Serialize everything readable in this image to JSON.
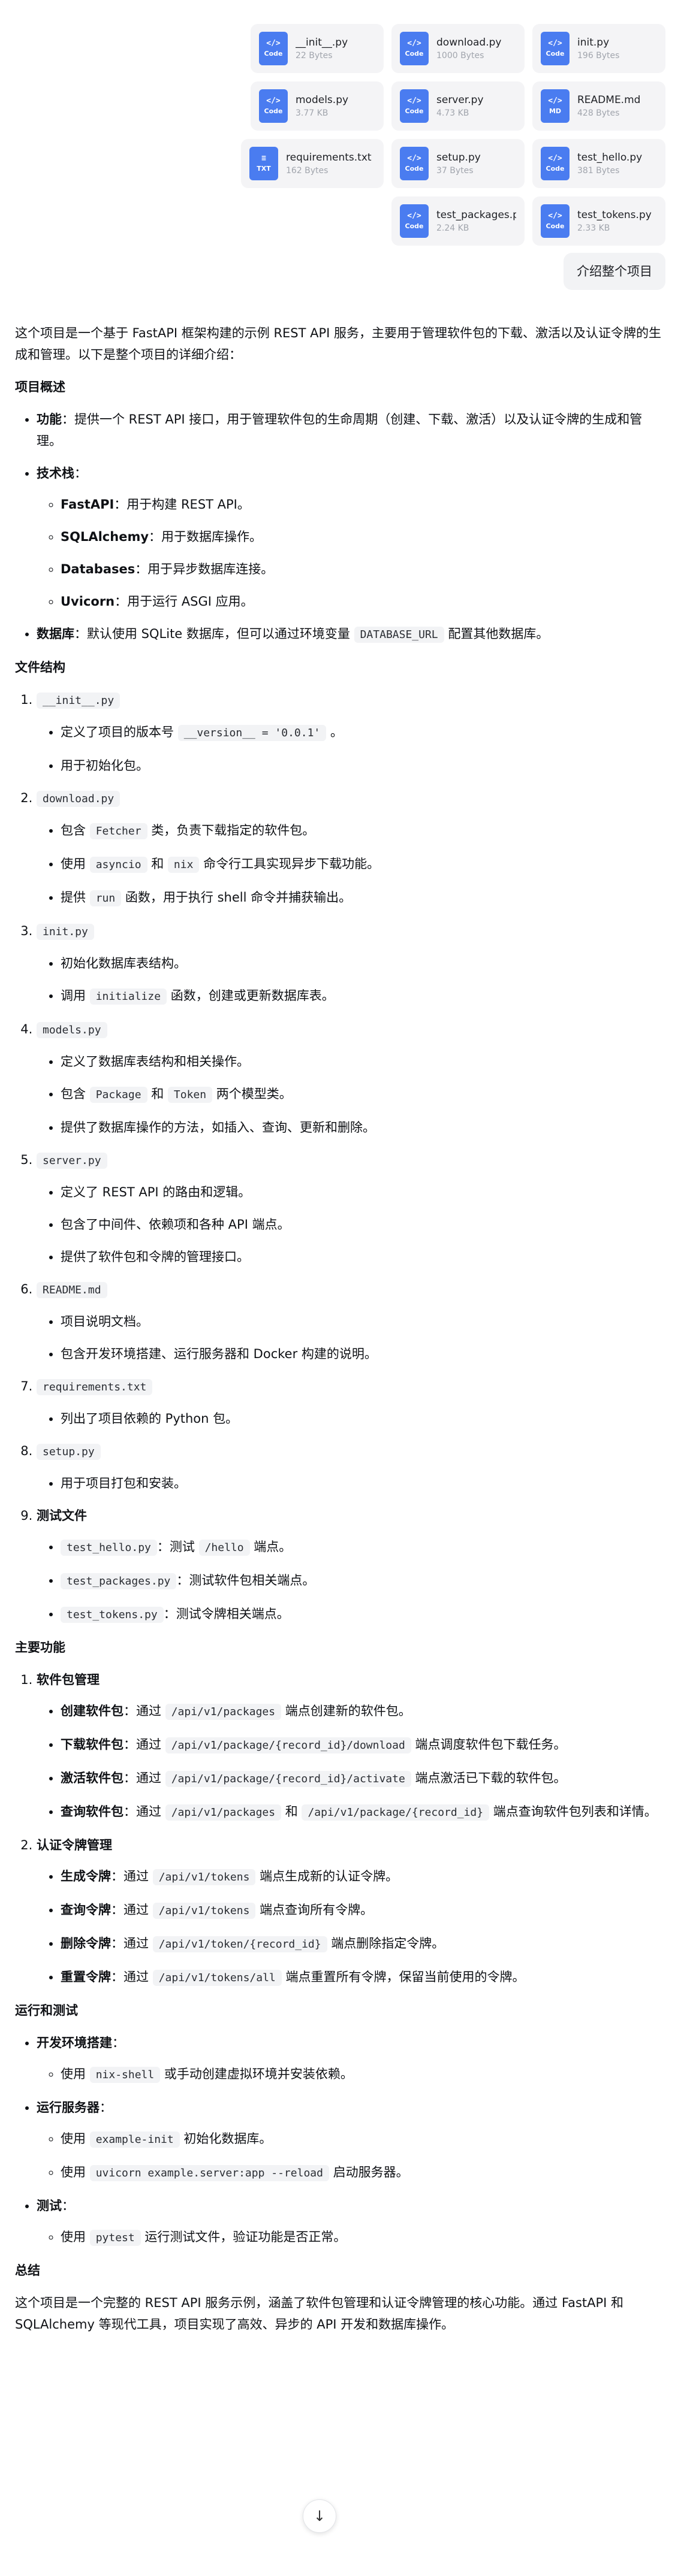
{
  "files": [
    [
      {
        "name": "__init__.py",
        "size": "22 Bytes",
        "icon": "Code",
        "glyph": "</>"
      },
      {
        "name": "download.py",
        "size": "1000 Bytes",
        "icon": "Code",
        "glyph": "</>"
      },
      {
        "name": "init.py",
        "size": "196 Bytes",
        "icon": "Code",
        "glyph": "</>"
      }
    ],
    [
      {
        "name": "models.py",
        "size": "3.77 KB",
        "icon": "Code",
        "glyph": "</>"
      },
      {
        "name": "server.py",
        "size": "4.73 KB",
        "icon": "Code",
        "glyph": "</>"
      },
      {
        "name": "README.md",
        "size": "428 Bytes",
        "icon": "MD",
        "glyph": "</>"
      }
    ],
    [
      {
        "name": "requirements.txt",
        "size": "162 Bytes",
        "icon": "TXT",
        "glyph": "≡"
      },
      {
        "name": "setup.py",
        "size": "37 Bytes",
        "icon": "Code",
        "glyph": "</>"
      },
      {
        "name": "test_hello.py",
        "size": "381 Bytes",
        "icon": "Code",
        "glyph": "</>"
      }
    ],
    [
      {
        "name": "test_packages.py",
        "size": "2.24 KB",
        "icon": "Code",
        "glyph": "</>"
      },
      {
        "name": "test_tokens.py",
        "size": "2.33 KB",
        "icon": "Code",
        "glyph": "</>"
      }
    ]
  ],
  "user_message": "介绍整个项目",
  "intro": "这个项目是一个基于 FastAPI 框架构建的示例 REST API 服务，主要用于管理软件包的下载、激活以及认证令牌的生成和管理。以下是整个项目的详细介绍：",
  "overview": {
    "heading": "项目概述",
    "func_label": "功能",
    "func_text": "：提供一个 REST API 接口，用于管理软件包的生命周期（创建、下载、激活）以及认证令牌的生成和管理。",
    "stack_label": "技术栈",
    "stack_colon": "：",
    "stack": [
      {
        "name": "FastAPI",
        "desc": "：用于构建 REST API。"
      },
      {
        "name": "SQLAlchemy",
        "desc": "：用于数据库操作。"
      },
      {
        "name": "Databases",
        "desc": "：用于异步数据库连接。"
      },
      {
        "name": "Uvicorn",
        "desc": "：用于运行 ASGI 应用。"
      }
    ],
    "db_label": "数据库",
    "db_text_1": "：默认使用 SQLite 数据库，但可以通过环境变量",
    "db_code": "DATABASE_URL",
    "db_text_2": "配置其他数据库。"
  },
  "structure": {
    "heading": "文件结构",
    "f1": {
      "name": "__init__.py",
      "i1a": "定义了项目的版本号",
      "i1code": "__version__ = '0.0.1'",
      "i1b": "。",
      "i2": "用于初始化包。"
    },
    "f2": {
      "name": "download.py",
      "i1a": "包含",
      "i1code": "Fetcher",
      "i1b": "类，负责下载指定的软件包。",
      "i2a": "使用",
      "i2code1": "asyncio",
      "i2mid": "和",
      "i2code2": "nix",
      "i2b": "命令行工具实现异步下载功能。",
      "i3a": "提供",
      "i3code": "run",
      "i3b": "函数，用于执行 shell 命令并捕获输出。"
    },
    "f3": {
      "name": "init.py",
      "i1": "初始化数据库表结构。",
      "i2a": "调用",
      "i2code": "initialize",
      "i2b": "函数，创建或更新数据库表。"
    },
    "f4": {
      "name": "models.py",
      "i1": "定义了数据库表结构和相关操作。",
      "i2a": "包含",
      "i2code1": "Package",
      "i2mid": "和",
      "i2code2": "Token",
      "i2b": "两个模型类。",
      "i3": "提供了数据库操作的方法，如插入、查询、更新和删除。"
    },
    "f5": {
      "name": "server.py",
      "i1": "定义了 REST API 的路由和逻辑。",
      "i2": "包含了中间件、依赖项和各种 API 端点。",
      "i3": "提供了软件包和令牌的管理接口。"
    },
    "f6": {
      "name": "README.md",
      "i1": "项目说明文档。",
      "i2": "包含开发环境搭建、运行服务器和 Docker 构建的说明。"
    },
    "f7": {
      "name": "requirements.txt",
      "i1": "列出了项目依赖的 Python 包。"
    },
    "f8": {
      "name": "setup.py",
      "i1": "用于项目打包和安装。"
    },
    "f9": {
      "label": "测试文件",
      "t1_code": "test_hello.py",
      "t1_a": "：测试",
      "t1_code2": "/hello",
      "t1_b": "端点。",
      "t2_code": "test_packages.py",
      "t2_a": "：测试软件包相关端点。",
      "t3_code": "test_tokens.py",
      "t3_a": "：测试令牌相关端点。"
    }
  },
  "features": {
    "heading": "主要功能",
    "pkg": {
      "label": "软件包管理",
      "create_label": "创建软件包",
      "create_a": "：通过",
      "create_code": "/api/v1/packages",
      "create_b": "端点创建新的软件包。",
      "download_label": "下载软件包",
      "download_a": "：通过",
      "download_code": "/api/v1/package/{record_id}/download",
      "download_b": "端点调度软件包下载任务。",
      "activate_label": "激活软件包",
      "activate_a": "：通过",
      "activate_code": "/api/v1/package/{record_id}/activate",
      "activate_b": "端点激活已下载的软件包。",
      "query_label": "查询软件包",
      "query_a": "：通过",
      "query_code1": "/api/v1/packages",
      "query_mid": "和",
      "query_code2": "/api/v1/package/{record_id}",
      "query_b": "端点查询软件包列表和详情。"
    },
    "tok": {
      "label": "认证令牌管理",
      "gen_label": "生成令牌",
      "gen_a": "：通过",
      "gen_code": "/api/v1/tokens",
      "gen_b": "端点生成新的认证令牌。",
      "query_label": "查询令牌",
      "query_a": "：通过",
      "query_code": "/api/v1/tokens",
      "query_b": "端点查询所有令牌。",
      "del_label": "删除令牌",
      "del_a": "：通过",
      "del_code": "/api/v1/token/{record_id}",
      "del_b": "端点删除指定令牌。",
      "reset_label": "重置令牌",
      "reset_a": "：通过",
      "reset_code": "/api/v1/tokens/all",
      "reset_b": "端点重置所有令牌，保留当前使用的令牌。"
    }
  },
  "run": {
    "heading": "运行和测试",
    "dev_label": "开发环境搭建",
    "dev_a": "使用",
    "dev_code": "nix-shell",
    "dev_b": "或手动创建虚拟环境并安装依赖。",
    "srv_label": "运行服务器",
    "srv1_a": "使用",
    "srv1_code": "example-init",
    "srv1_b": "初始化数据库。",
    "srv2_a": "使用",
    "srv2_code": "uvicorn example.server:app --reload",
    "srv2_b": "启动服务器。",
    "test_label": "测试",
    "test_a": "使用",
    "test_code": "pytest",
    "test_b": "运行测试文件，验证功能是否正常。",
    "colon": "："
  },
  "summary": {
    "heading": "总结",
    "text": "这个项目是一个完整的 REST API 服务示例，涵盖了软件包管理和认证令牌管理的核心功能。通过 FastAPI 和 SQLAlchemy 等现代工具，项目实现了高效、异步的 API 开发和数据库操作。"
  },
  "scroll_glyph": "↓"
}
